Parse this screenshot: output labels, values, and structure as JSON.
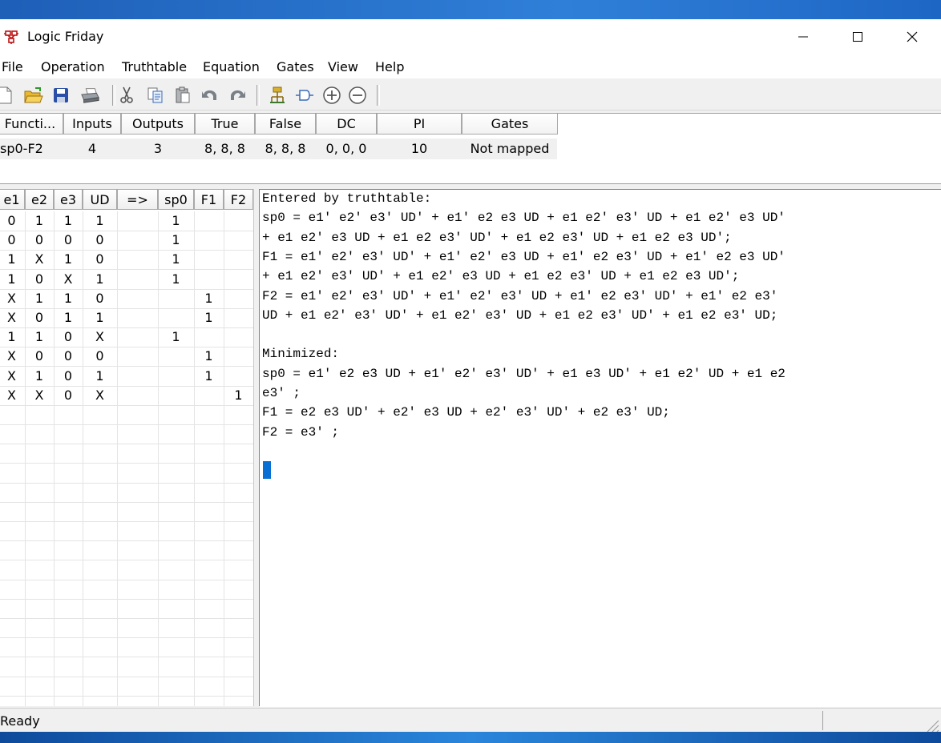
{
  "window": {
    "title": "Logic Friday"
  },
  "menu": [
    "File",
    "Operation",
    "Truthtable",
    "Equation",
    "Gates",
    "View",
    "Help"
  ],
  "toolbar": {
    "buttons": [
      "new-icon",
      "open-icon",
      "save-icon",
      "print-icon",
      "cut-icon",
      "copy-icon",
      "paste-icon",
      "undo-icon",
      "redo-icon",
      "gate-icon",
      "buffer-icon",
      "add-icon",
      "remove-icon"
    ]
  },
  "function_list": {
    "headers": [
      "Functi...",
      "Inputs",
      "Outputs",
      "True",
      "False",
      "DC",
      "PI",
      "Gates"
    ],
    "row": [
      "sp0-F2",
      "4",
      "3",
      "8, 8, 8",
      "8, 8, 8",
      "0, 0, 0",
      "10",
      "Not mapped"
    ]
  },
  "truth_table": {
    "headers": [
      "e1",
      "e2",
      "e3",
      "UD",
      "=>",
      "sp0",
      "F1",
      "F2"
    ],
    "rows": [
      [
        "0",
        "1",
        "1",
        "1",
        "",
        "1",
        "",
        ""
      ],
      [
        "0",
        "0",
        "0",
        "0",
        "",
        "1",
        "",
        ""
      ],
      [
        "1",
        "X",
        "1",
        "0",
        "",
        "1",
        "",
        ""
      ],
      [
        "1",
        "0",
        "X",
        "1",
        "",
        "1",
        "",
        ""
      ],
      [
        "X",
        "1",
        "1",
        "0",
        "",
        "",
        "1",
        ""
      ],
      [
        "X",
        "0",
        "1",
        "1",
        "",
        "",
        "1",
        ""
      ],
      [
        "1",
        "1",
        "0",
        "X",
        "",
        "1",
        "",
        ""
      ],
      [
        "X",
        "0",
        "0",
        "0",
        "",
        "",
        "1",
        ""
      ],
      [
        "X",
        "1",
        "0",
        "1",
        "",
        "",
        "1",
        ""
      ],
      [
        "X",
        "X",
        "0",
        "X",
        "",
        "",
        "",
        "1"
      ]
    ]
  },
  "equations": {
    "lines": [
      "Entered by truthtable:",
      "sp0 = e1' e2' e3' UD' + e1' e2 e3 UD + e1 e2' e3' UD + e1 e2' e3 UD'",
      "+ e1 e2' e3 UD + e1 e2 e3' UD' + e1 e2 e3' UD + e1 e2 e3 UD';",
      "F1 = e1' e2' e3' UD' + e1' e2' e3 UD + e1' e2 e3' UD + e1' e2 e3 UD'",
      "+ e1 e2' e3' UD' + e1 e2' e3 UD + e1 e2 e3' UD + e1 e2 e3 UD';",
      "F2 = e1' e2' e3' UD' + e1' e2' e3' UD + e1' e2 e3' UD' + e1' e2 e3'",
      "UD + e1 e2' e3' UD' + e1 e2' e3' UD + e1 e2 e3' UD' + e1 e2 e3' UD;",
      "",
      "Minimized:",
      "sp0 = e1' e2 e3 UD + e1' e2' e3' UD' + e1 e3 UD' + e1 e2' UD + e1 e2",
      "e3' ;",
      "F1 = e2 e3 UD' + e2' e3 UD + e2' e3' UD' + e2 e3' UD;",
      "F2 = e3' ;"
    ]
  },
  "status": {
    "text": "Ready"
  },
  "colors": {
    "caret": "#0a6fd4",
    "desktop": "#1565c8"
  }
}
